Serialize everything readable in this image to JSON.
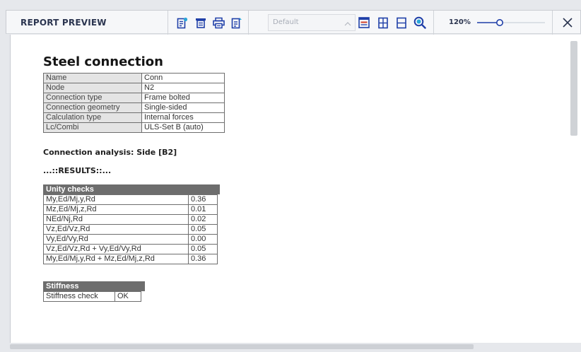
{
  "toolbar": {
    "title": "REPORT PREVIEW",
    "template_combo": {
      "value": "Default"
    },
    "zoom_label": "120%",
    "icons": [
      "export-icon",
      "page-setup-icon",
      "print-icon",
      "export-text-icon",
      "layout-icon",
      "fit-width-icon",
      "fit-page-icon",
      "zoom-icon",
      "close-icon"
    ],
    "accent_color": "#1f3fa8"
  },
  "document": {
    "title": "Steel connection",
    "info_rows": [
      {
        "key": "Name",
        "value": "Conn"
      },
      {
        "key": "Node",
        "value": "N2"
      },
      {
        "key": "Connection type",
        "value": "Frame bolted"
      },
      {
        "key": "Connection geometry",
        "value": "Single-sided"
      },
      {
        "key": "Calculation type",
        "value": "Internal forces"
      },
      {
        "key": "Lc/Combi",
        "value": "ULS-Set B (auto)"
      }
    ],
    "analysis_heading": "Connection analysis:  Side [B2]",
    "results_heading": "...::RESULTS::...",
    "unity_checks": {
      "header": "Unity  checks",
      "rows": [
        {
          "key": "My,Ed/Mj,y,Rd",
          "value": "0.36"
        },
        {
          "key": "Mz,Ed/Mj,z,Rd",
          "value": "0.01"
        },
        {
          "key": "NEd/Nj,Rd",
          "value": "0.02"
        },
        {
          "key": "Vz,Ed/Vz,Rd",
          "value": "0.05"
        },
        {
          "key": "Vy,Ed/Vy,Rd",
          "value": "0.00"
        },
        {
          "key": "Vz,Ed/Vz,Rd  + Vy,Ed/Vy,Rd",
          "value": "0.05"
        },
        {
          "key": "My,Ed/Mj,y,Rd  + Mz,Ed/Mj,z,Rd",
          "value": "0.36"
        }
      ]
    },
    "stiffness": {
      "header": "Stiffness",
      "rows": [
        {
          "key": "Stiffness  check",
          "value": "OK"
        }
      ]
    }
  }
}
